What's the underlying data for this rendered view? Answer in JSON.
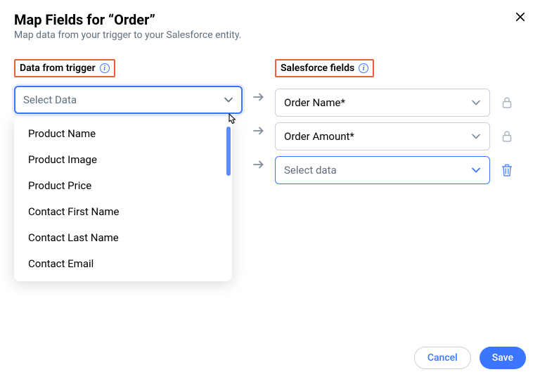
{
  "header": {
    "title": "Map Fields for “Order”",
    "subtitle": "Map data from your trigger to your Salesforce entity."
  },
  "leftColumn": {
    "label": "Data from trigger",
    "placeholder": "Select Data",
    "options": [
      "Product Name",
      "Product Image",
      "Product Price",
      "Contact First Name",
      "Contact Last Name",
      "Contact Email"
    ]
  },
  "rightColumn": {
    "label": "Salesforce fields",
    "rows": [
      {
        "value": "Order Name*",
        "locked": true
      },
      {
        "value": "Order Amount*",
        "locked": true
      },
      {
        "placeholder": "Select data",
        "deletable": true
      }
    ]
  },
  "footer": {
    "cancel": "Cancel",
    "save": "Save"
  }
}
